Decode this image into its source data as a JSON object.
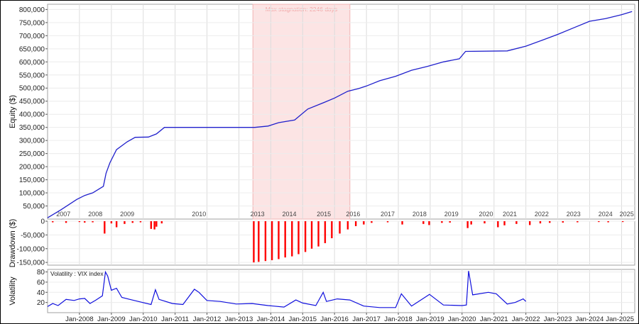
{
  "chart_data": [
    {
      "type": "line",
      "ylabel": "Equity ($)",
      "ylim": [
        0,
        820000
      ],
      "yticks": [
        50000,
        100000,
        150000,
        200000,
        250000,
        300000,
        350000,
        400000,
        450000,
        500000,
        550000,
        600000,
        650000,
        700000,
        750000,
        800000
      ],
      "ytick_labels": [
        "50,000",
        "100,000",
        "150,000",
        "200,000",
        "250,000",
        "300,000",
        "350,000",
        "400,000",
        "450,000",
        "500,000",
        "550,000",
        "600,000",
        "650,000",
        "700,000",
        "750,000",
        "800,000"
      ],
      "annotation": "Max stagnation: 2246 days",
      "stagnation_span": [
        "2013-06-10",
        "2016-06-25"
      ],
      "color": "#2020cc",
      "year_labels": [
        {
          "x": "2007-07-01",
          "label": "2007"
        },
        {
          "x": "2008-07-01",
          "label": "2008"
        },
        {
          "x": "2009-07-01",
          "label": "2009"
        },
        {
          "x": "2011-10-01",
          "label": "2010"
        },
        {
          "x": "2013-08-01",
          "label": "2013"
        },
        {
          "x": "2014-08-01",
          "label": "2014"
        },
        {
          "x": "2015-09-01",
          "label": "2015"
        },
        {
          "x": "2016-08-01",
          "label": "2016"
        },
        {
          "x": "2017-09-01",
          "label": "2017"
        },
        {
          "x": "2018-09-01",
          "label": "2018"
        },
        {
          "x": "2019-09-01",
          "label": "2019"
        },
        {
          "x": "2020-10-01",
          "label": "2020"
        },
        {
          "x": "2021-07-01",
          "label": "2021"
        },
        {
          "x": "2022-07-01",
          "label": "2022"
        },
        {
          "x": "2023-07-01",
          "label": "2023"
        },
        {
          "x": "2024-07-01",
          "label": "2024"
        },
        {
          "x": "2025-03-01",
          "label": "2025"
        }
      ],
      "points": [
        [
          "2007-01-01",
          5000
        ],
        [
          "2007-06-01",
          35000
        ],
        [
          "2007-12-01",
          75000
        ],
        [
          "2008-03-01",
          90000
        ],
        [
          "2008-06-01",
          100000
        ],
        [
          "2008-10-01",
          125000
        ],
        [
          "2008-11-01",
          175000
        ],
        [
          "2008-12-15",
          215000
        ],
        [
          "2009-03-01",
          265000
        ],
        [
          "2009-07-01",
          295000
        ],
        [
          "2009-10-01",
          312000
        ],
        [
          "2010-03-01",
          313000
        ],
        [
          "2010-06-01",
          325000
        ],
        [
          "2010-09-01",
          350000
        ],
        [
          "2013-07-01",
          350000
        ],
        [
          "2013-12-01",
          355000
        ],
        [
          "2014-04-01",
          368000
        ],
        [
          "2014-10-01",
          378000
        ],
        [
          "2015-03-01",
          420000
        ],
        [
          "2015-09-01",
          445000
        ],
        [
          "2016-01-01",
          462000
        ],
        [
          "2016-06-01",
          488000
        ],
        [
          "2016-10-01",
          498000
        ],
        [
          "2017-01-01",
          508000
        ],
        [
          "2017-06-01",
          528000
        ],
        [
          "2017-12-01",
          545000
        ],
        [
          "2018-06-01",
          568000
        ],
        [
          "2018-12-01",
          583000
        ],
        [
          "2019-06-01",
          600000
        ],
        [
          "2019-12-01",
          612000
        ],
        [
          "2020-02-10",
          640000
        ],
        [
          "2021-06-01",
          642000
        ],
        [
          "2022-01-01",
          660000
        ],
        [
          "2022-07-01",
          682000
        ],
        [
          "2023-01-01",
          705000
        ],
        [
          "2023-07-01",
          730000
        ],
        [
          "2024-01-01",
          755000
        ],
        [
          "2024-07-01",
          765000
        ],
        [
          "2025-01-01",
          780000
        ],
        [
          "2025-05-01",
          792000
        ]
      ]
    },
    {
      "type": "bar",
      "ylabel": "Drawdown ($)",
      "ylim": [
        -160000,
        0
      ],
      "yticks": [
        0,
        -50000,
        -100000,
        -150000
      ],
      "ytick_labels": [
        "0",
        "-50,000",
        "-100,000",
        "-150,000"
      ],
      "color": "#ff0000",
      "values": [
        [
          "2007-03-01",
          -4000
        ],
        [
          "2007-08-01",
          -6000
        ],
        [
          "2008-01-01",
          -3000
        ],
        [
          "2008-03-01",
          -5000
        ],
        [
          "2008-06-01",
          -4000
        ],
        [
          "2008-10-15",
          -45000
        ],
        [
          "2009-01-01",
          -8000
        ],
        [
          "2009-03-01",
          -22000
        ],
        [
          "2009-06-01",
          -10000
        ],
        [
          "2009-09-01",
          -6000
        ],
        [
          "2009-12-01",
          -4000
        ],
        [
          "2010-04-01",
          -28000
        ],
        [
          "2010-05-10",
          -30000
        ],
        [
          "2010-06-01",
          -20000
        ],
        [
          "2010-08-01",
          -8000
        ],
        [
          "2013-06-20",
          -150000
        ],
        [
          "2013-08-15",
          -148000
        ],
        [
          "2013-11-01",
          -145000
        ],
        [
          "2014-01-15",
          -142000
        ],
        [
          "2014-04-01",
          -138000
        ],
        [
          "2014-06-15",
          -132000
        ],
        [
          "2014-09-01",
          -128000
        ],
        [
          "2014-11-15",
          -120000
        ],
        [
          "2015-02-01",
          -112000
        ],
        [
          "2015-04-15",
          -100000
        ],
        [
          "2015-07-01",
          -92000
        ],
        [
          "2015-09-15",
          -80000
        ],
        [
          "2015-12-01",
          -62000
        ],
        [
          "2016-03-01",
          -45000
        ],
        [
          "2016-06-01",
          -30000
        ],
        [
          "2016-09-01",
          -18000
        ],
        [
          "2016-12-01",
          -12000
        ],
        [
          "2017-03-01",
          -6000
        ],
        [
          "2017-09-01",
          -4000
        ],
        [
          "2018-02-15",
          -12000
        ],
        [
          "2018-10-15",
          -10000
        ],
        [
          "2018-12-20",
          -14000
        ],
        [
          "2019-05-15",
          -6000
        ],
        [
          "2019-08-15",
          -5000
        ],
        [
          "2020-03-05",
          -25000
        ],
        [
          "2020-04-15",
          -12000
        ],
        [
          "2020-09-15",
          -8000
        ],
        [
          "2021-02-15",
          -22000
        ],
        [
          "2021-05-01",
          -15000
        ],
        [
          "2021-09-15",
          -10000
        ],
        [
          "2022-02-15",
          -14000
        ],
        [
          "2022-06-15",
          -8000
        ],
        [
          "2022-10-01",
          -6000
        ],
        [
          "2023-03-01",
          -5000
        ],
        [
          "2023-08-15",
          -4000
        ],
        [
          "2024-04-15",
          -3000
        ],
        [
          "2024-08-01",
          -4000
        ],
        [
          "2025-01-15",
          -3000
        ]
      ]
    },
    {
      "type": "line",
      "title": "Volatility : VIX index",
      "ylabel": "Volatility",
      "ylim": [
        0,
        85
      ],
      "yticks": [
        20,
        40,
        60,
        80
      ],
      "ytick_labels": [
        "20",
        "40",
        "60",
        "80"
      ],
      "color": "#1010dd",
      "series": [
        {
          "name": "VIX index",
          "points": [
            [
              "2007-01-01",
              12
            ],
            [
              "2007-03-01",
              18
            ],
            [
              "2007-05-01",
              14
            ],
            [
              "2007-08-01",
              26
            ],
            [
              "2007-11-01",
              24
            ],
            [
              "2008-01-01",
              27
            ],
            [
              "2008-03-01",
              28
            ],
            [
              "2008-05-01",
              18
            ],
            [
              "2008-07-01",
              24
            ],
            [
              "2008-09-20",
              33
            ],
            [
              "2008-10-25",
              80
            ],
            [
              "2008-11-20",
              72
            ],
            [
              "2008-12-31",
              44
            ],
            [
              "2009-03-01",
              48
            ],
            [
              "2009-05-01",
              30
            ],
            [
              "2009-08-01",
              26
            ],
            [
              "2009-12-01",
              21
            ],
            [
              "2010-04-01",
              16
            ],
            [
              "2010-05-20",
              45
            ],
            [
              "2010-07-01",
              26
            ],
            [
              "2010-12-01",
              18
            ],
            [
              "2011-04-01",
              16
            ],
            [
              "2011-08-10",
              46
            ],
            [
              "2011-10-01",
              40
            ],
            [
              "2011-12-31",
              24
            ],
            [
              "2012-06-01",
              22
            ],
            [
              "2012-12-01",
              17
            ],
            [
              "2013-06-01",
              18
            ],
            [
              "2013-12-01",
              14
            ],
            [
              "2014-06-01",
              11
            ],
            [
              "2014-10-15",
              25
            ],
            [
              "2014-12-31",
              19
            ],
            [
              "2015-06-01",
              14
            ],
            [
              "2015-08-24",
              40
            ],
            [
              "2015-10-01",
              22
            ],
            [
              "2016-02-01",
              27
            ],
            [
              "2016-06-24",
              25
            ],
            [
              "2016-12-01",
              13
            ],
            [
              "2017-06-01",
              10
            ],
            [
              "2017-12-01",
              10
            ],
            [
              "2018-02-05",
              37
            ],
            [
              "2018-06-01",
              13
            ],
            [
              "2018-12-24",
              36
            ],
            [
              "2019-06-01",
              15
            ],
            [
              "2019-12-31",
              14
            ],
            [
              "2020-02-20",
              15
            ],
            [
              "2020-03-16",
              82
            ],
            [
              "2020-05-01",
              35
            ],
            [
              "2020-10-28",
              40
            ],
            [
              "2021-01-27",
              37
            ],
            [
              "2021-06-01",
              17
            ],
            [
              "2021-09-01",
              20
            ],
            [
              "2021-12-01",
              27
            ],
            [
              "2022-01-01",
              22
            ]
          ]
        }
      ]
    },
    {
      "type": "axis",
      "x_range": [
        "2007-01-01",
        "2025-06-01"
      ],
      "ticks": [
        {
          "x": "2008-01-01",
          "label": "Jan-2008"
        },
        {
          "x": "2009-01-01",
          "label": "Jan-2009"
        },
        {
          "x": "2010-01-01",
          "label": "Jan-2010"
        },
        {
          "x": "2011-01-01",
          "label": "Jan-2011"
        },
        {
          "x": "2012-01-01",
          "label": "Jan-2012"
        },
        {
          "x": "2013-01-01",
          "label": "Jan-2013"
        },
        {
          "x": "2014-01-01",
          "label": "Jan-2014"
        },
        {
          "x": "2015-01-01",
          "label": "Jan-2015"
        },
        {
          "x": "2016-01-01",
          "label": "Jan-2016"
        },
        {
          "x": "2017-01-01",
          "label": "Jan-2017"
        },
        {
          "x": "2018-01-01",
          "label": "Jan-2018"
        },
        {
          "x": "2019-01-01",
          "label": "Jan-2019"
        },
        {
          "x": "2020-01-01",
          "label": "Jan-2020"
        },
        {
          "x": "2021-01-01",
          "label": "Jan-2021"
        },
        {
          "x": "2022-01-01",
          "label": "Jan-2022"
        },
        {
          "x": "2023-01-01",
          "label": "Jan-2023"
        },
        {
          "x": "2024-01-01",
          "label": "Jan-2024"
        },
        {
          "x": "2025-01-01",
          "label": "Jan-2025"
        }
      ]
    }
  ]
}
